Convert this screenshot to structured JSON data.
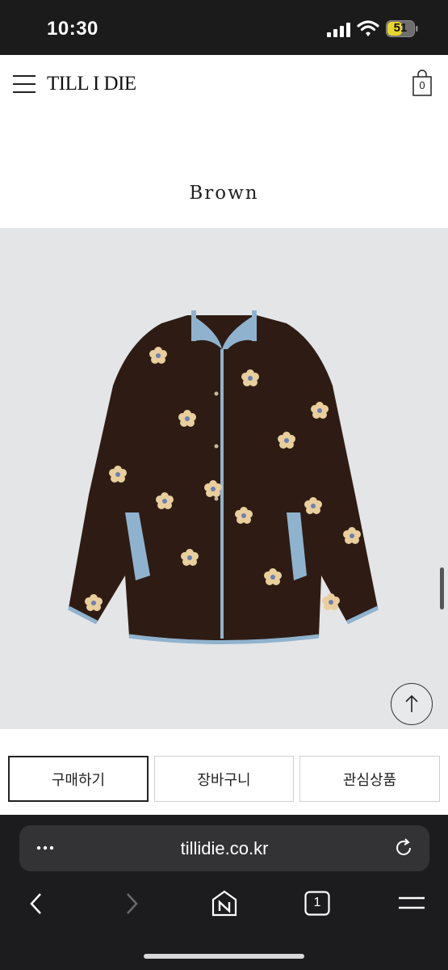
{
  "status_bar": {
    "time": "10:30",
    "battery_level": "51",
    "signal_icon": "cellular-signal-icon",
    "wifi_icon": "wifi-icon",
    "battery_icon": "battery-icon"
  },
  "header": {
    "brand": "TILL I DIE",
    "menu_icon": "hamburger-menu-icon",
    "cart_icon": "shopping-bag-icon",
    "cart_count": "0"
  },
  "product": {
    "color_name": "Brown",
    "image_description_icon": "floral-fleece-jacket-image",
    "jacket_color": "#2e1c14",
    "trim_color": "#8fb3cf",
    "background_color": "#e4e5e7"
  },
  "actions": {
    "buy_label": "구매하기",
    "cart_label": "장바구니",
    "wishlist_label": "관심상품"
  },
  "scroll_top_icon": "arrow-up-icon",
  "browser": {
    "url": "tillidie.co.kr",
    "more_icon": "ellipsis-icon",
    "reload_icon": "reload-icon",
    "back_icon": "chevron-left-icon",
    "forward_icon": "chevron-right-icon",
    "home_icon": "naver-home-icon",
    "tabs_count": "1",
    "tabs_icon": "tabs-icon",
    "menu_icon": "hamburger-menu-icon"
  }
}
